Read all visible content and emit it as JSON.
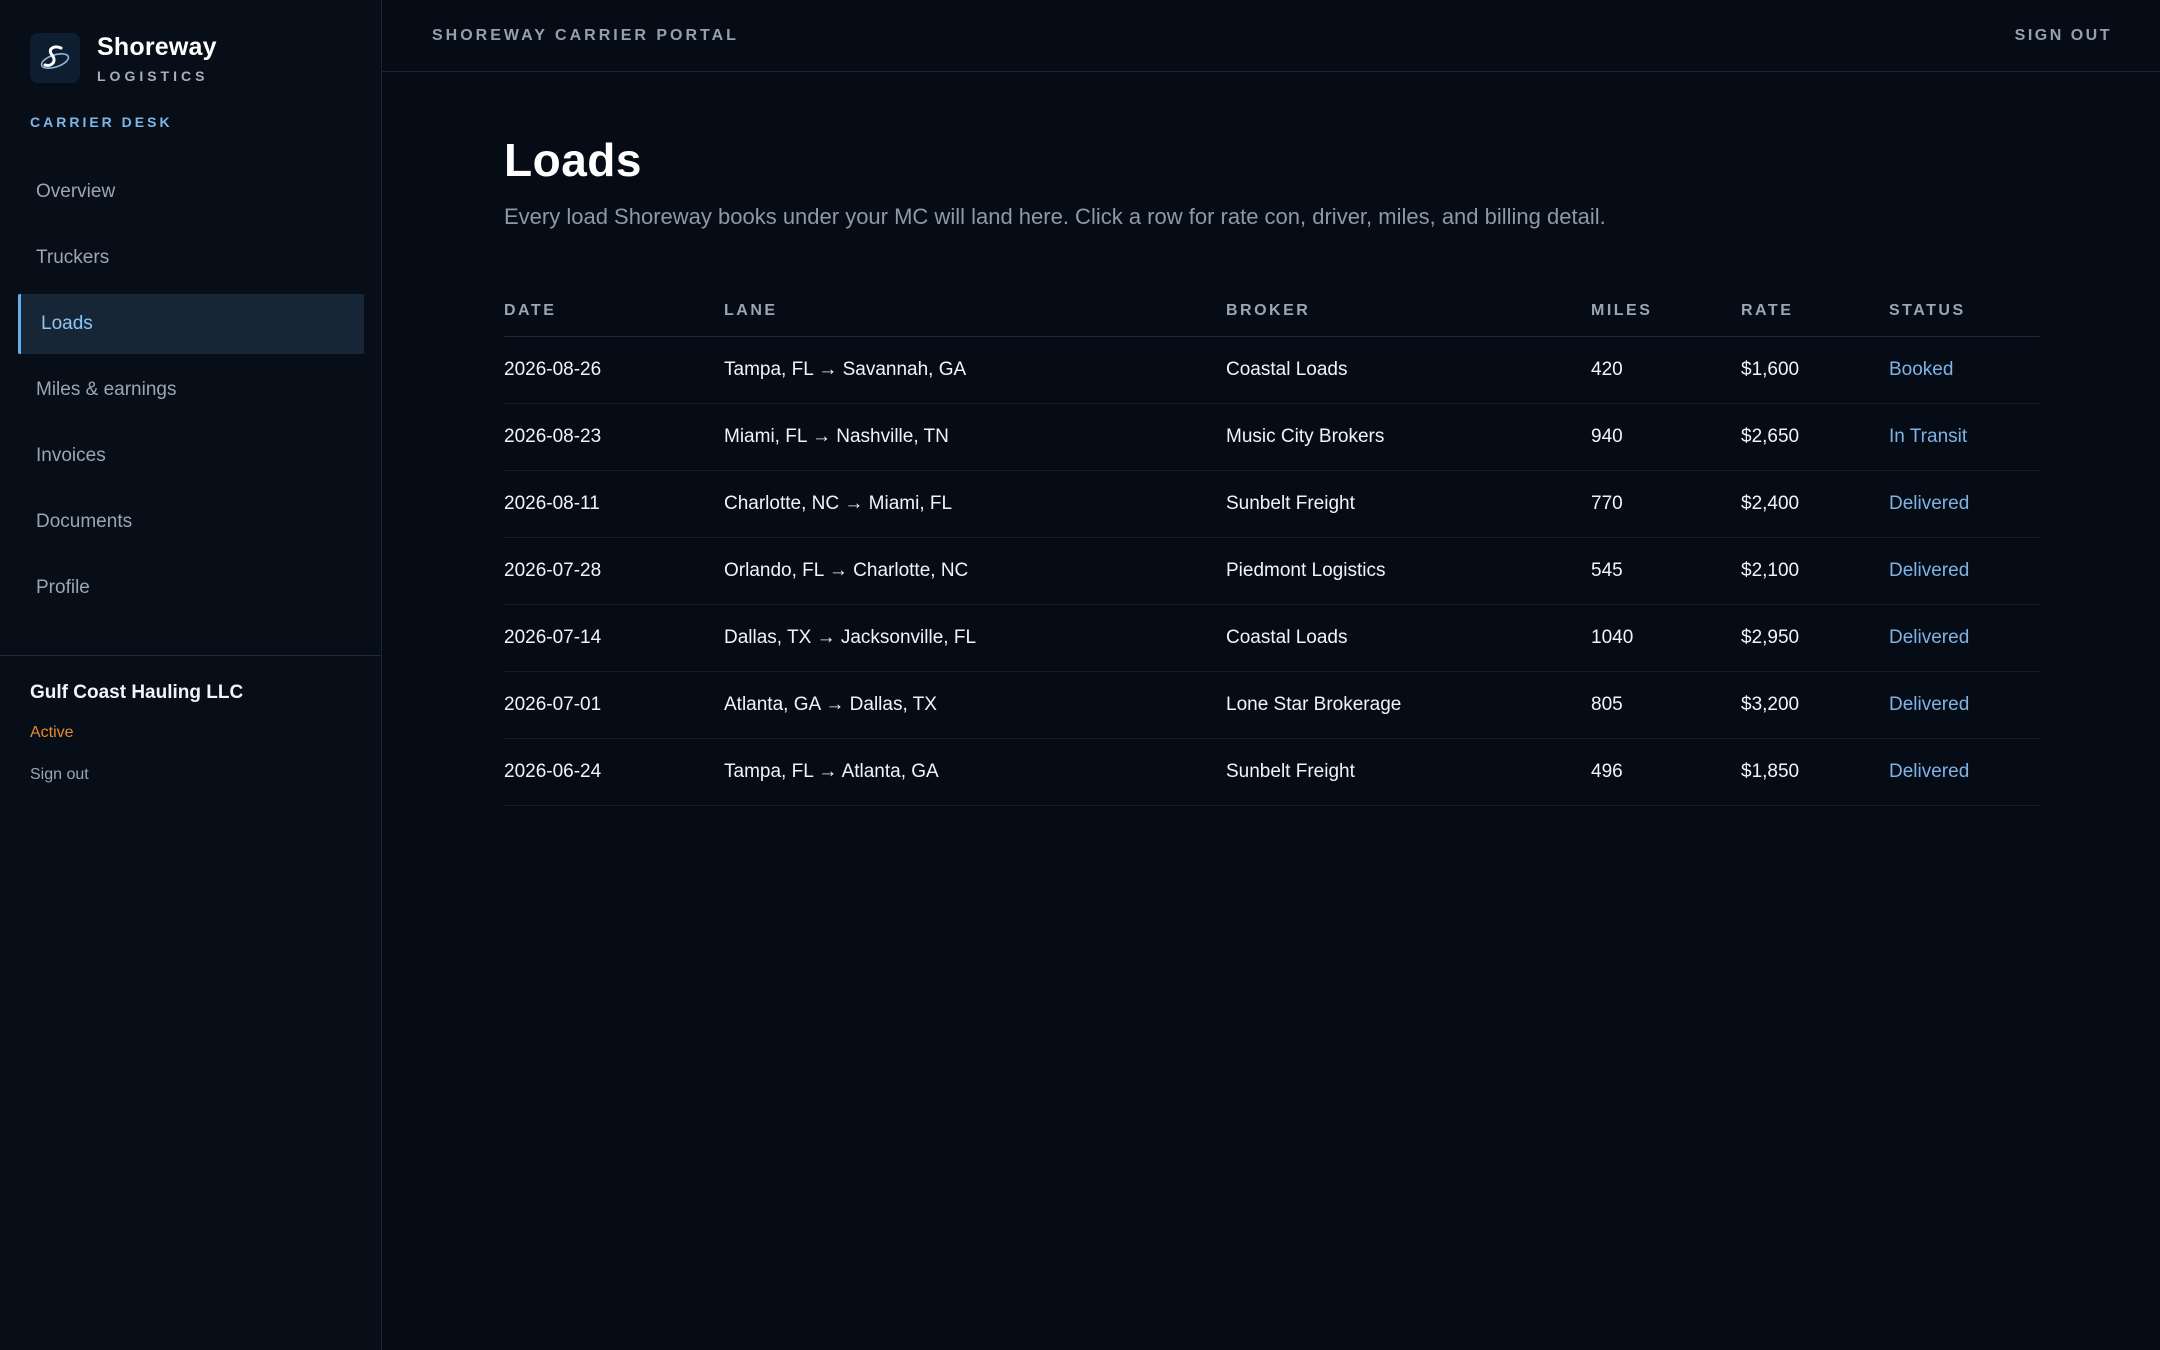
{
  "brand": {
    "name": "Shoreway",
    "sub": "LOGISTICS"
  },
  "sidebar": {
    "section_label": "CARRIER DESK",
    "items": [
      {
        "label": "Overview",
        "active": false
      },
      {
        "label": "Truckers",
        "active": false
      },
      {
        "label": "Loads",
        "active": true
      },
      {
        "label": "Miles & earnings",
        "active": false
      },
      {
        "label": "Invoices",
        "active": false
      },
      {
        "label": "Documents",
        "active": false
      },
      {
        "label": "Profile",
        "active": false
      }
    ],
    "company": "Gulf Coast Hauling LLC",
    "status": "Active",
    "sign_out": "Sign out"
  },
  "header": {
    "portal_title": "SHOREWAY CARRIER PORTAL",
    "sign_out": "SIGN OUT"
  },
  "page": {
    "title": "Loads",
    "description": "Every load Shoreway books under your MC will land here. Click a row for rate con, driver, miles, and billing detail."
  },
  "table": {
    "columns": [
      "DATE",
      "LANE",
      "BROKER",
      "MILES",
      "RATE",
      "STATUS"
    ],
    "rows": [
      {
        "date": "2026-08-26",
        "lane": "Tampa, FL → Savannah, GA",
        "broker": "Coastal Loads",
        "miles": "420",
        "rate": "$1,600",
        "status": "Booked"
      },
      {
        "date": "2026-08-23",
        "lane": "Miami, FL → Nashville, TN",
        "broker": "Music City Brokers",
        "miles": "940",
        "rate": "$2,650",
        "status": "In Transit"
      },
      {
        "date": "2026-08-11",
        "lane": "Charlotte, NC → Miami, FL",
        "broker": "Sunbelt Freight",
        "miles": "770",
        "rate": "$2,400",
        "status": "Delivered"
      },
      {
        "date": "2026-07-28",
        "lane": "Orlando, FL → Charlotte, NC",
        "broker": "Piedmont Logistics",
        "miles": "545",
        "rate": "$2,100",
        "status": "Delivered"
      },
      {
        "date": "2026-07-14",
        "lane": "Dallas, TX → Jacksonville, FL",
        "broker": "Coastal Loads",
        "miles": "1040",
        "rate": "$2,950",
        "status": "Delivered"
      },
      {
        "date": "2026-07-01",
        "lane": "Atlanta, GA → Dallas, TX",
        "broker": "Lone Star Brokerage",
        "miles": "805",
        "rate": "$3,200",
        "status": "Delivered"
      },
      {
        "date": "2026-06-24",
        "lane": "Tampa, FL → Atlanta, GA",
        "broker": "Sunbelt Freight",
        "miles": "496",
        "rate": "$1,850",
        "status": "Delivered"
      }
    ]
  },
  "colors": {
    "background": "#060c15",
    "accent": "#7fb6ea",
    "active_status": "#e68a2e"
  }
}
